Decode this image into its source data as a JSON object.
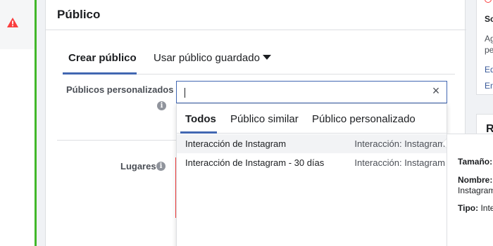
{
  "left_rail": {
    "icon": "warning-icon",
    "accent_color": "#42b72a",
    "icon_color": "#fa3e3e"
  },
  "panel": {
    "title": "Público",
    "tabs": [
      {
        "label": "Crear público",
        "active": true
      },
      {
        "label": "Usar público guardado",
        "active": false
      }
    ],
    "custom_audiences_label": "Públicos personalizados",
    "locations_label": "Lugares",
    "search": {
      "value": "",
      "placeholder": ""
    },
    "dropdown": {
      "tabs": [
        {
          "label": "Todos",
          "active": true
        },
        {
          "label": "Público similar",
          "active": false
        },
        {
          "label": "Público personalizado",
          "active": false
        }
      ],
      "items": [
        {
          "name": "Interacción de Instagram",
          "type": "Interacción: Instagram",
          "highlighted": true
        },
        {
          "name": "Interacción de Instagram - 30 días",
          "type": "Interacción: Instagram",
          "highlighted": false
        }
      ]
    }
  },
  "right_card_top": {
    "heading": "Sc",
    "line1": "Ag",
    "line2": "pe",
    "link1": "Ed",
    "link2": "En"
  },
  "right_card_bottom": {
    "heading": "R"
  },
  "tooltip": {
    "size_label": "Tamaño:",
    "name_label": "Nombre:",
    "name_value": "Instagram",
    "type_label": "Tipo:",
    "type_value": "Inte"
  },
  "colors": {
    "accent": "#4267b2",
    "divider": "#dddfe2",
    "error": "#fa3e3e",
    "link": "#385898"
  }
}
